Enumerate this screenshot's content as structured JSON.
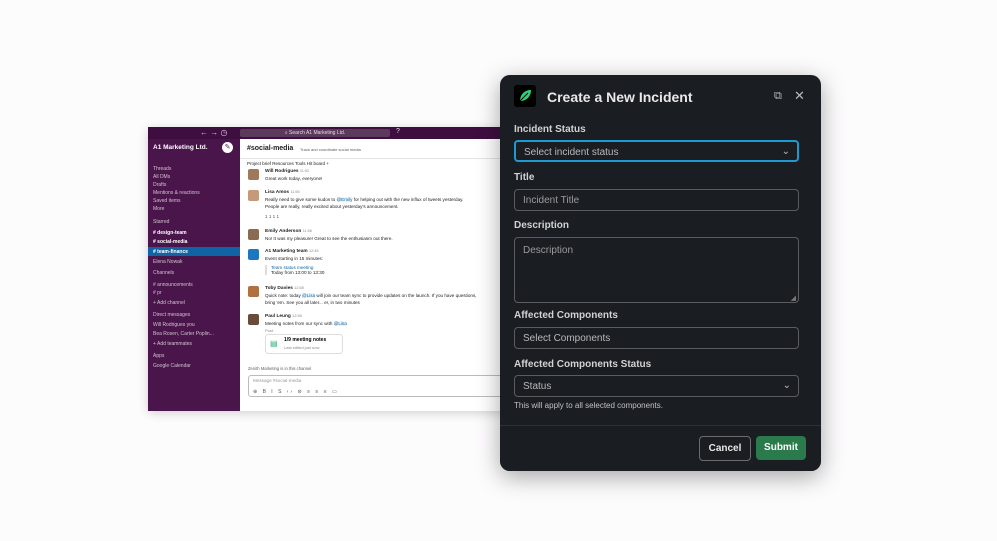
{
  "slack": {
    "search_text": "Search A1 Marketing Ltd.",
    "workspace": "A1 Marketing Ltd.",
    "sidebar": [
      {
        "label": "Threads",
        "bold": false
      },
      {
        "label": "All DMs",
        "bold": false
      },
      {
        "label": "Drafts",
        "bold": false
      },
      {
        "label": "Mentions & reactions",
        "bold": false
      },
      {
        "label": "Saved items",
        "bold": false
      },
      {
        "label": "More",
        "bold": false
      },
      {
        "label": "Starred",
        "bold": false
      },
      {
        "label": "# design-team",
        "bold": true
      },
      {
        "label": "# social-media",
        "bold": true
      },
      {
        "label": "# team-finance",
        "bold": true
      },
      {
        "label": "Elena Nowak",
        "bold": false
      },
      {
        "label": "Channels",
        "bold": false
      },
      {
        "label": "# announcements",
        "bold": false
      },
      {
        "label": "# pr",
        "bold": false
      },
      {
        "label": "+ Add channel",
        "bold": false
      },
      {
        "label": "Direct messages",
        "bold": false
      },
      {
        "label": "Will Rodrigues you",
        "bold": false
      },
      {
        "label": "Bea Rosen, Carter Poplin...",
        "bold": false
      },
      {
        "label": "+ Add teammates",
        "bold": false
      },
      {
        "label": "Apps",
        "bold": false
      },
      {
        "label": "Google Calendar",
        "bold": false
      }
    ],
    "channel": "#social-media",
    "topic": "Track and coordinate social media",
    "bookmarks": "Project brief   Resources   Tools   Hit board   +",
    "messages": {
      "m1_name": "Will Rodrigues",
      "m1_time": "11:52",
      "m1_text": "Great work today, everyone!",
      "m2_name": "Lisa Amos",
      "m2_time": "11:55",
      "m2_text1a": "Really need to give some kudos to ",
      "m2_mention": "@Emily",
      "m2_text1b": " for helping out with the new influx of tweets yesterday.",
      "m2_text2": "People are really, really excited about yesterday's announcement.",
      "m2_reacts": "1   1   1   1",
      "m3_name": "Emily Anderson",
      "m3_time": "11:56",
      "m3_text": "No! It was my pleasure! Great to see the enthusiasm out there.",
      "m4_name": "A1 Marketing team",
      "m4_time": "12:45",
      "m4_text": "Event starting in 15 minutes:",
      "m4_event": "Team status meeting",
      "m4_when": "Today from 13:00 to 13:30",
      "m5_name": "Toby Davies",
      "m5_time": "12:58",
      "m5_text1a": "Quick note: today ",
      "m5_mention": "@Lisa",
      "m5_text1b": " will join our team sync to provide updates on the launch. If you have questions,",
      "m5_text2": "bring 'em. See you all later... er, in two minutes",
      "m6_name": "Paul Leung",
      "m6_time": "12:58",
      "m6_text": "Meeting notes from our sync with ",
      "m6_mention": "@Lisa",
      "m6_post": "Post",
      "doc_title": "1/9 meeting notes",
      "doc_sub": "Last edited just now"
    },
    "join_note": "Zenith Marketing is in this channel",
    "composer_placeholder": "Message #social-media"
  },
  "modal": {
    "title": "Create a New Incident",
    "status_label": "Incident Status",
    "status_value": "Select incident status",
    "title_label": "Title",
    "title_placeholder": "Incident Title",
    "desc_label": "Description",
    "desc_placeholder": "Description",
    "components_label": "Affected Components",
    "components_placeholder": "Select Components",
    "comp_status_label": "Affected Components Status",
    "comp_status_value": "Status",
    "hint": "This will apply to all selected components.",
    "cancel": "Cancel",
    "submit": "Submit",
    "accent": "#1d9bd1",
    "submit_color": "#2b7a4b"
  }
}
